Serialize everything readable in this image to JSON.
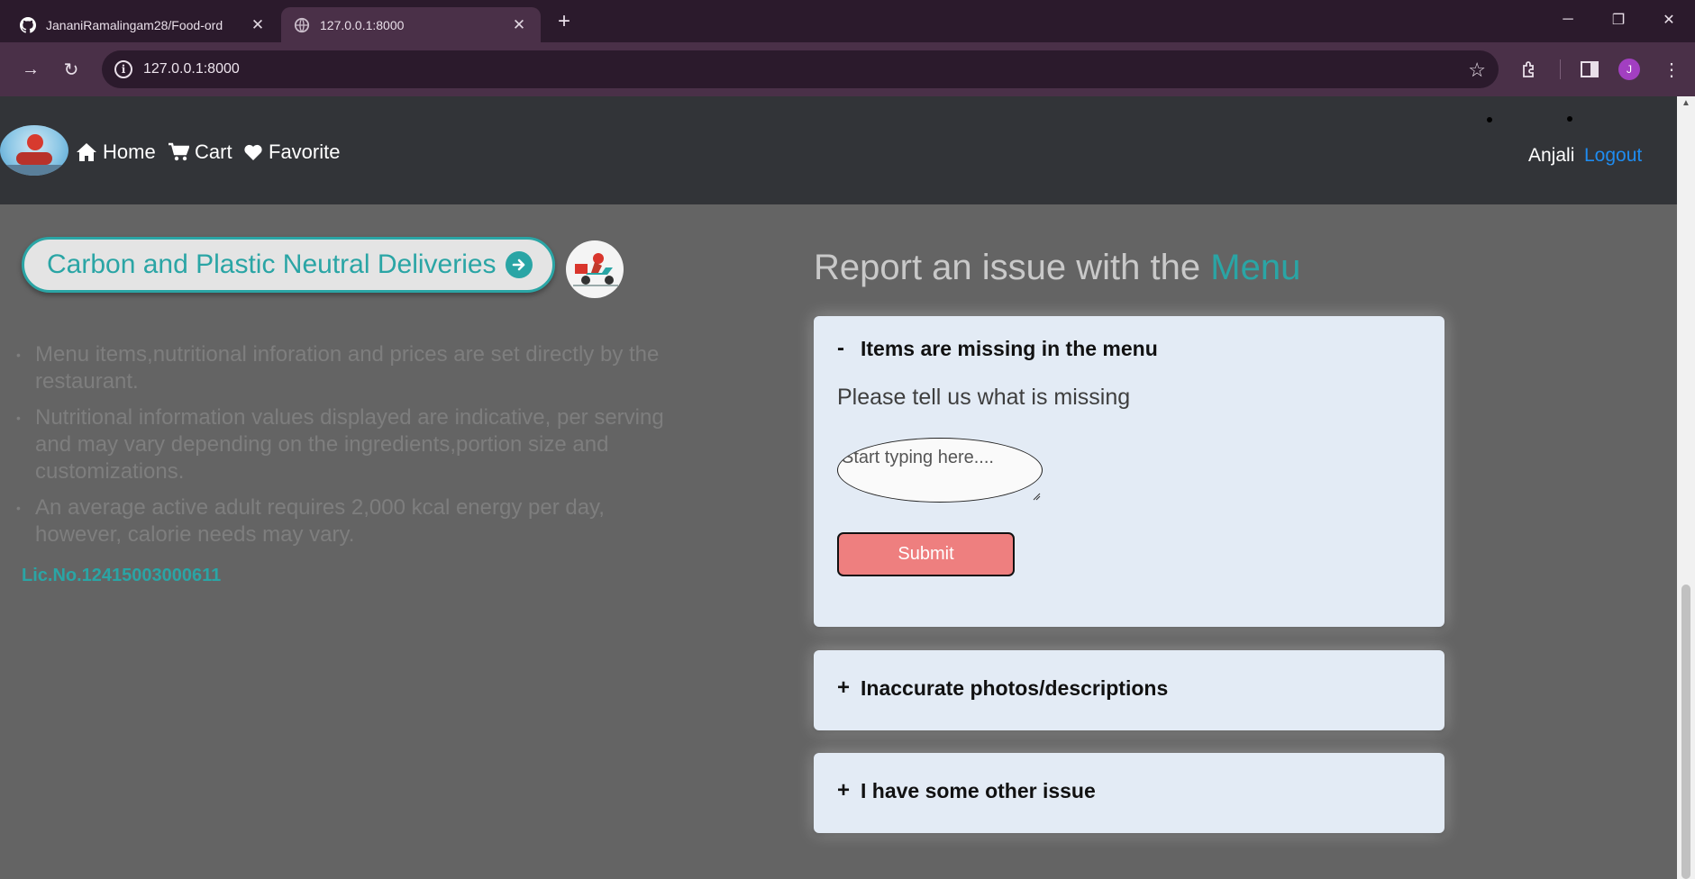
{
  "browser": {
    "tabs": [
      {
        "title": "JananiRamalingam28/Food-ord",
        "icon": "github-icon",
        "active": false
      },
      {
        "title": "127.0.0.1:8000",
        "icon": "globe-icon",
        "active": true
      }
    ],
    "url": "127.0.0.1:8000",
    "profile_initial": "J",
    "colors": {
      "frame": "#2b1a2c",
      "toolbar": "#4a3048",
      "profile": "#a23fc1"
    }
  },
  "navbar": {
    "links": [
      {
        "label": "Home",
        "icon": "home-icon"
      },
      {
        "label": "Cart",
        "icon": "cart-icon"
      },
      {
        "label": "Favorite",
        "icon": "heart-icon"
      }
    ],
    "user_name": "Anjali",
    "logout_label": "Logout"
  },
  "left": {
    "carbon_button_label": "Carbon and Plastic Neutral Deliveries",
    "notes": [
      "Menu items,nutritional inforation and prices are set directly by the restaurant.",
      "Nutritional information values displayed are indicative, per serving and may vary depending on the ingredients,portion size and customizations.",
      "An average active adult requires 2,000 kcal energy per day, however, calorie needs may vary."
    ],
    "license": "Lic.No.12415003000611"
  },
  "report": {
    "title_prefix": "Report an issue with the",
    "title_accent": "Menu",
    "sections": [
      {
        "sign": "-",
        "title": "Items are missing in the menu",
        "expanded": true,
        "prompt": "Please tell us what is missing",
        "placeholder": "Start typing here....",
        "submit_label": "Submit"
      },
      {
        "sign": "+",
        "title": "Inaccurate photos/descriptions",
        "expanded": false
      },
      {
        "sign": "+",
        "title": "I have some other issue",
        "expanded": false
      }
    ]
  },
  "colors": {
    "accent": "#2aa5a5",
    "logout": "#1f8cf0",
    "submit": "#ee7f7f",
    "card": "#e3ebf5",
    "page": "#646464",
    "navbar": "#323438"
  }
}
